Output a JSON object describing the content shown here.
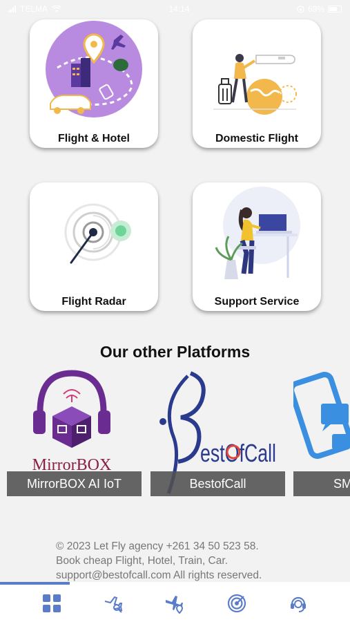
{
  "status_bar": {
    "carrier": "TELMA",
    "time": "14:14",
    "battery": "69%"
  },
  "services": [
    {
      "label": "Flight & Hotel",
      "icon": "flight-hotel-illustration"
    },
    {
      "label": "Domestic Flight",
      "icon": "domestic-flight-illustration"
    },
    {
      "label": "Flight Radar",
      "icon": "radar-illustration"
    },
    {
      "label": "Support Service",
      "icon": "support-service-illustration"
    }
  ],
  "platforms_title": "Our other Platforms",
  "platforms": [
    {
      "caption": "MirrorBOX AI IoT",
      "logo_text": "MirrorBOX"
    },
    {
      "caption": "BestofCall",
      "logo_text": "estOfCall"
    },
    {
      "caption": "SM"
    }
  ],
  "footer": {
    "line1": "© 2023 Let Fly agency +261 34 50 523 58.",
    "line2": "Book cheap Flight, Hotel, Train, Car.",
    "line3": "support@bestofcall.com All rights reserved."
  },
  "page_progress": 0.2,
  "tabbar": [
    {
      "name": "home-grid-icon",
      "active": true
    },
    {
      "name": "flight-search-icon"
    },
    {
      "name": "flight-location-icon"
    },
    {
      "name": "radar-icon"
    },
    {
      "name": "support-agent-icon"
    }
  ],
  "colors": {
    "accent": "#5b7cc9",
    "background": "#f2f2f2",
    "mirrorbox_purple": "#6a2c91",
    "bestofcall_blue": "#2a3a8c",
    "sm_blue": "#3a8fe0"
  }
}
